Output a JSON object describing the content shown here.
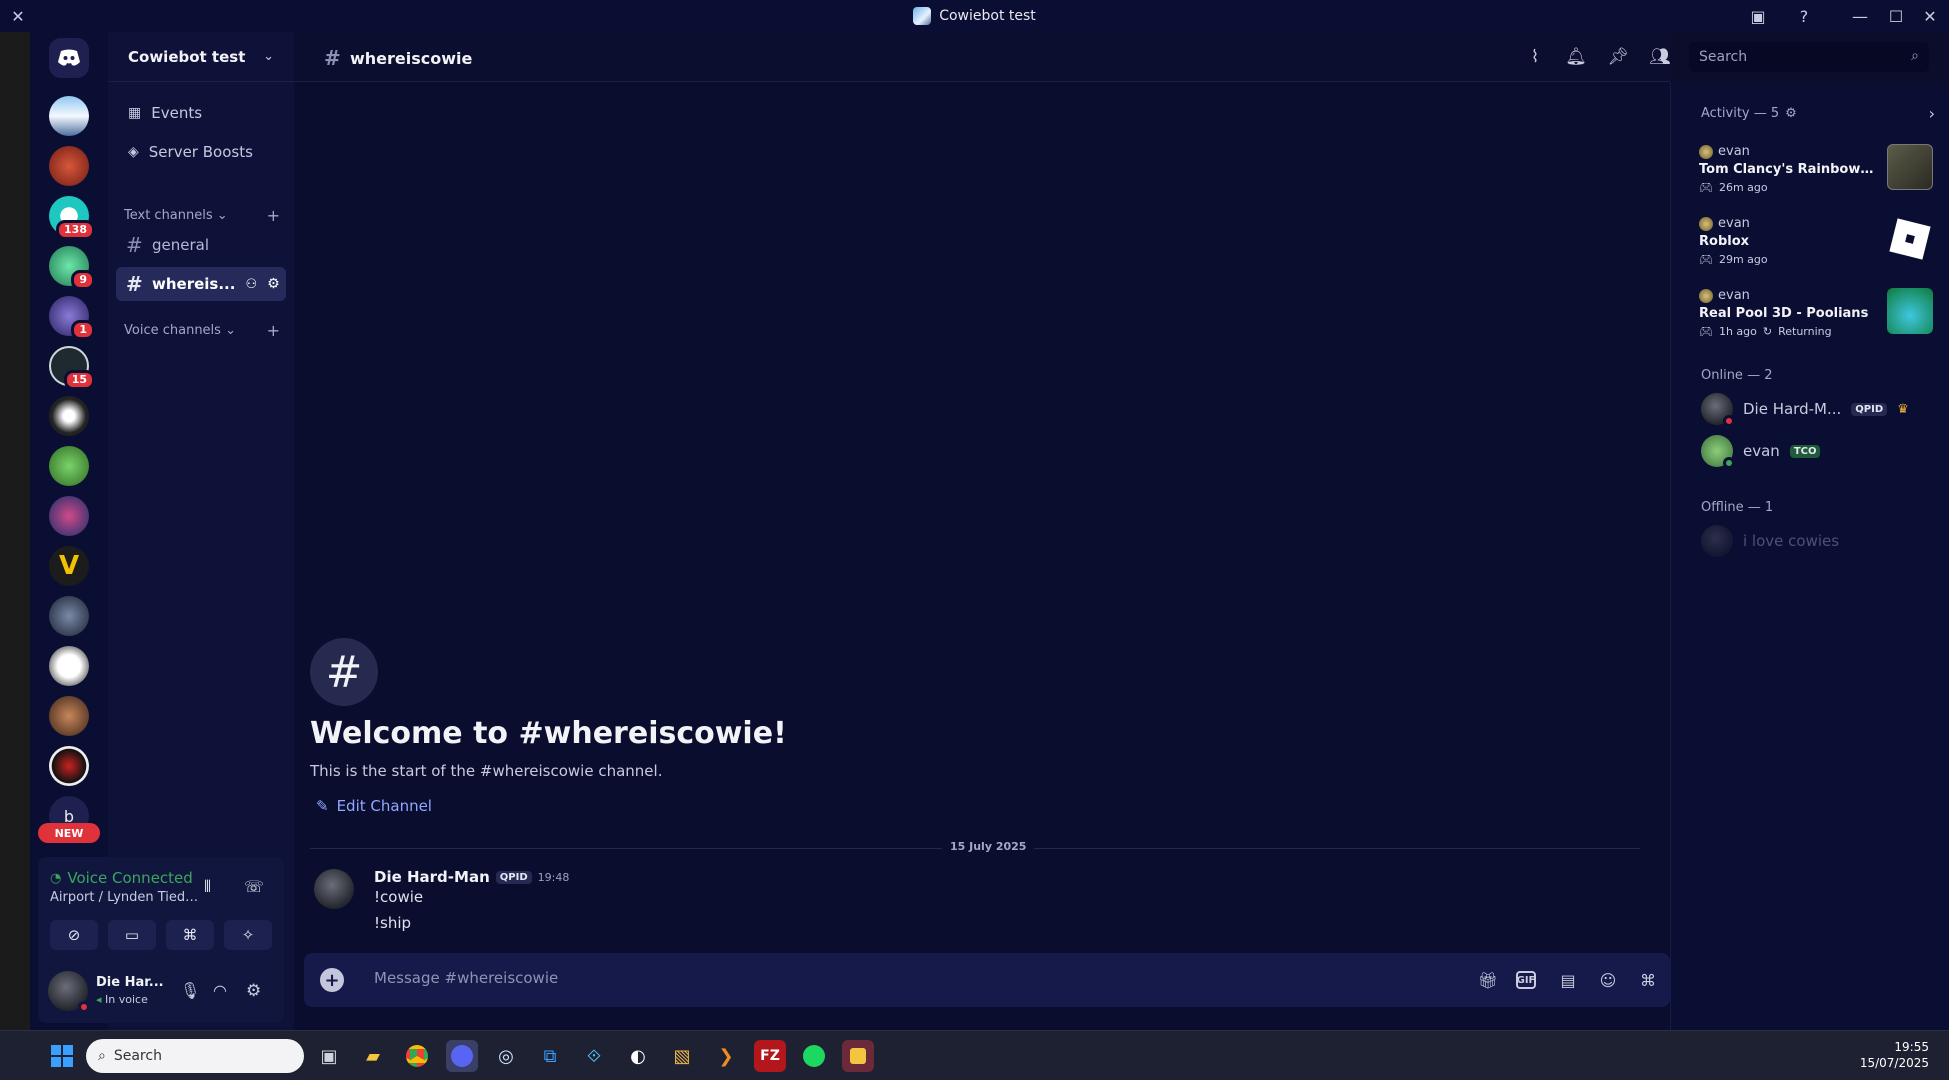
{
  "window": {
    "title": "Cowiebot test"
  },
  "server": {
    "name": "Cowiebot test",
    "nav": [
      {
        "label": "Events",
        "icon": "calendar-icon"
      },
      {
        "label": "Server Boosts",
        "icon": "boost-icon"
      }
    ],
    "text_category": "Text channels",
    "voice_category": "Voice channels",
    "channels": [
      {
        "name": "general",
        "active": false
      },
      {
        "name": "whereis...",
        "active": true
      }
    ]
  },
  "rail": {
    "badges": [
      "138",
      "9",
      "1",
      "15"
    ],
    "new_label": "NEW",
    "letter_server": "b"
  },
  "voice": {
    "status": "Voice Connected",
    "location": "Airport / Lynden Tied ..."
  },
  "user": {
    "name": "Die Har...",
    "status": "In voice"
  },
  "chat": {
    "channel": "whereiscowie",
    "search_placeholder": "Search",
    "welcome_title": "Welcome to #whereiscowie!",
    "welcome_sub": "This is the start of the #whereiscowie channel.",
    "edit_label": "Edit Channel",
    "date_divider": "15 July 2025",
    "message": {
      "author": "Die Hard-Man",
      "tag": "QPID",
      "time": "19:48",
      "lines": [
        "!cowie",
        "!ship"
      ]
    },
    "composer_placeholder": "Message #whereiscowie"
  },
  "members": {
    "activity_header": "Activity — 5",
    "activities": [
      {
        "user": "evan",
        "game": "Tom Clancy's Rainbow Six S...",
        "when": "26m ago",
        "extra": ""
      },
      {
        "user": "evan",
        "game": "Roblox",
        "when": "29m ago",
        "extra": ""
      },
      {
        "user": "evan",
        "game": "Real Pool 3D - Poolians",
        "when": "1h ago",
        "extra": "Returning"
      }
    ],
    "online_header": "Online — 2",
    "online": [
      {
        "name": "Die Hard-M...",
        "tag": "QPID",
        "status_color": "#e0323b"
      },
      {
        "name": "evan",
        "tag": "TCO",
        "status_color": "#3ba55d"
      }
    ],
    "offline_header": "Offline — 1",
    "offline": [
      {
        "name": "i love cowies"
      }
    ]
  },
  "taskbar": {
    "search_placeholder": "Search",
    "time": "19:55",
    "date": "15/07/2025"
  },
  "colors": {
    "accent_green": "#3ba55d",
    "link_blue": "#8ea9ff",
    "danger_red": "#e0323b"
  }
}
